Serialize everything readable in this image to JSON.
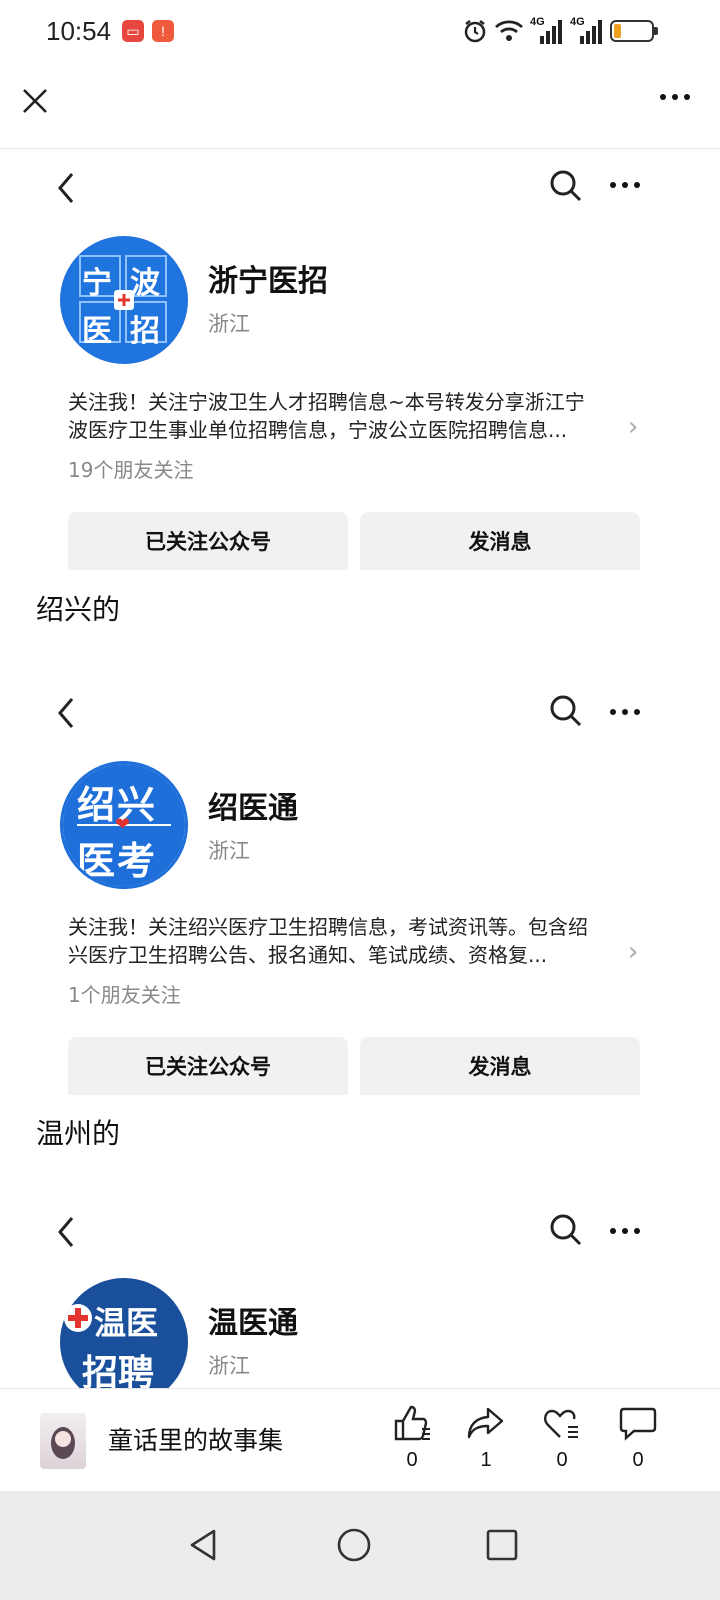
{
  "status": {
    "time": "10:54",
    "network1": "4G",
    "network2": "4G"
  },
  "topbar": {
    "close_icon": "close-icon",
    "more_icon": "more-icon"
  },
  "accounts": [
    {
      "name": "浙宁医招",
      "region": "浙江",
      "avatar_text": [
        "宁",
        "波",
        "医",
        "招"
      ],
      "description_line1": "关注我！关注宁波卫生人才招聘信息~本号转发分享浙江宁",
      "description_line2": "波医疗卫生事业单位招聘信息，宁波公立医院招聘信息...",
      "friends": "19个朋友关注",
      "followed_label": "已关注公众号",
      "message_label": "发消息"
    },
    {
      "name": "绍医通",
      "region": "浙江",
      "avatar_text": [
        "绍兴",
        "医考"
      ],
      "description_line1": "关注我！关注绍兴医疗卫生招聘信息，考试资讯等。包含绍",
      "description_line2": "兴医疗卫生招聘公告、报名通知、笔试成绩、资格复...",
      "friends": "1个朋友关注",
      "followed_label": "已关注公众号",
      "message_label": "发消息"
    },
    {
      "name": "温医通",
      "region": "浙江",
      "avatar_text": [
        "温医",
        "招聘"
      ]
    }
  ],
  "section_labels": [
    "绍兴的",
    "温州的"
  ],
  "bottom": {
    "title": "童话里的故事集",
    "like_count": "0",
    "share_count": "1",
    "favorite_count": "0",
    "comment_count": "0"
  },
  "colors": {
    "accent_blue": "#1e6fd9",
    "red": "#e3342f"
  }
}
